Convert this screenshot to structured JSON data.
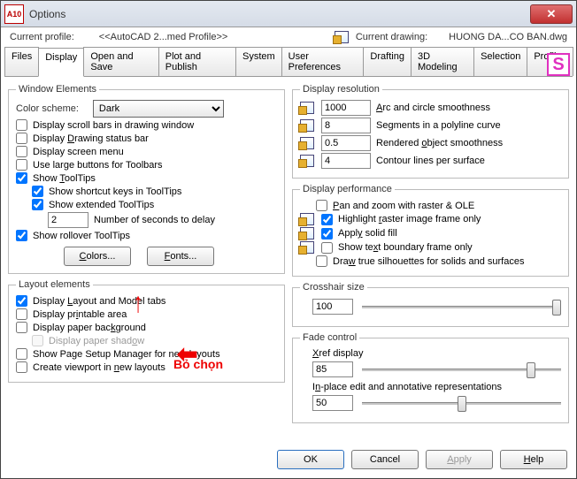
{
  "window": {
    "title": "Options",
    "app_icon": "A10"
  },
  "profile": {
    "label": "Current profile:",
    "value": "<<AutoCAD 2...med Profile>>",
    "drawing_label": "Current drawing:",
    "drawing_value": "HUONG DA...CO BAN.dwg"
  },
  "tabs": [
    "Files",
    "Display",
    "Open and Save",
    "Plot and Publish",
    "System",
    "User Preferences",
    "Drafting",
    "3D Modeling",
    "Selection",
    "Profiles"
  ],
  "active_tab": "Display",
  "window_elements": {
    "legend": "Window Elements",
    "color_scheme_label": "Color scheme:",
    "color_scheme_value": "Dark",
    "cb_scrollbars": "Display scroll bars in drawing window",
    "cb_statusbar": "Display Drawing status bar",
    "cb_screenmenu": "Display screen menu",
    "cb_largebuttons": "Use large buttons for Toolbars",
    "cb_tooltips": "Show ToolTips",
    "cb_shortcut": "Show shortcut keys in ToolTips",
    "cb_extended": "Show extended ToolTips",
    "seconds_value": "2",
    "seconds_label": "Number of seconds to delay",
    "cb_rollover": "Show rollover ToolTips",
    "btn_colors": "Colors...",
    "btn_fonts": "Fonts..."
  },
  "layout_elements": {
    "legend": "Layout elements",
    "cb_layout_model": "Display Layout and Model tabs",
    "cb_printable": "Display printable area",
    "cb_paperbg": "Display paper background",
    "cb_papershadow": "Display paper shadow",
    "cb_pagesetup": "Show Page Setup Manager for new layouts",
    "cb_viewport": "Create viewport in new layouts"
  },
  "display_resolution": {
    "legend": "Display resolution",
    "arc_value": "1000",
    "arc_label": "Arc and circle smoothness",
    "seg_value": "8",
    "seg_label": "Segments in a polyline curve",
    "rend_value": "0.5",
    "rend_label": "Rendered object smoothness",
    "cont_value": "4",
    "cont_label": "Contour lines per surface"
  },
  "display_performance": {
    "legend": "Display performance",
    "cb_pan": "Pan and zoom with raster & OLE",
    "cb_highlight": "Highlight raster image frame only",
    "cb_solidfill": "Apply solid fill",
    "cb_textbound": "Show text boundary frame only",
    "cb_truesilh": "Draw true silhouettes for solids and surfaces"
  },
  "crosshair": {
    "legend": "Crosshair size",
    "value": "100"
  },
  "fade": {
    "legend": "Fade control",
    "xref_label": "Xref display",
    "xref_value": "85",
    "inplace_label": "In-place edit and annotative representations",
    "inplace_value": "50"
  },
  "buttons": {
    "ok": "OK",
    "cancel": "Cancel",
    "apply": "Apply",
    "help": "Help"
  },
  "annotation": {
    "text": "Bỏ chọn"
  }
}
